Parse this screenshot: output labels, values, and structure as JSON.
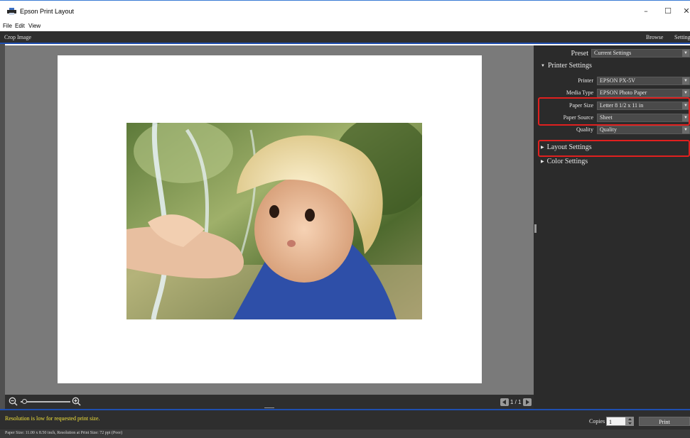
{
  "window": {
    "title": "Epson Print Layout",
    "controls": {
      "minimize": "–",
      "maximize": "☐",
      "close": "✕"
    }
  },
  "menu": {
    "items": [
      "File",
      "Edit",
      "View"
    ]
  },
  "toolbar": {
    "left_tab": "Crop Image",
    "right_tabs": [
      "Browse",
      "Settings"
    ]
  },
  "preview": {
    "image_icon": "photo-of-girl-in-sunhat-with-water-fountain",
    "zoom_level_fraction": 0.05,
    "page_counter": "1 / 1"
  },
  "panel": {
    "preset": {
      "label": "Preset",
      "value": "Current Settings"
    },
    "printer_settings": {
      "title": "Printer Settings",
      "rows": [
        {
          "label": "Printer",
          "value": "EPSON PX-5V"
        },
        {
          "label": "Media Type",
          "value": "EPSON Photo Paper"
        },
        {
          "label": "Paper Size",
          "value": "Letter 8 1/2 x 11 in"
        },
        {
          "label": "Paper Source",
          "value": "Sheet"
        },
        {
          "label": "Quality",
          "value": "Quality"
        }
      ]
    },
    "layout_settings": {
      "title": "Layout Settings"
    },
    "color_settings": {
      "title": "Color Settings"
    },
    "highlight_color": "#e0201f"
  },
  "status": {
    "warning": "Resolution is low for requested print size.",
    "copies_label": "Copies",
    "copies_value": "1",
    "print_label": "Print",
    "info": "Paper Size: 11.00 x 8.50 inch,   Resolution at Print Size: 72 ppi (Poor)"
  },
  "colors": {
    "accent": "#1f4fb0",
    "warning": "#f0e03a",
    "panel_bg": "#2b2b2b",
    "preview_bg": "#7a7a7a"
  }
}
